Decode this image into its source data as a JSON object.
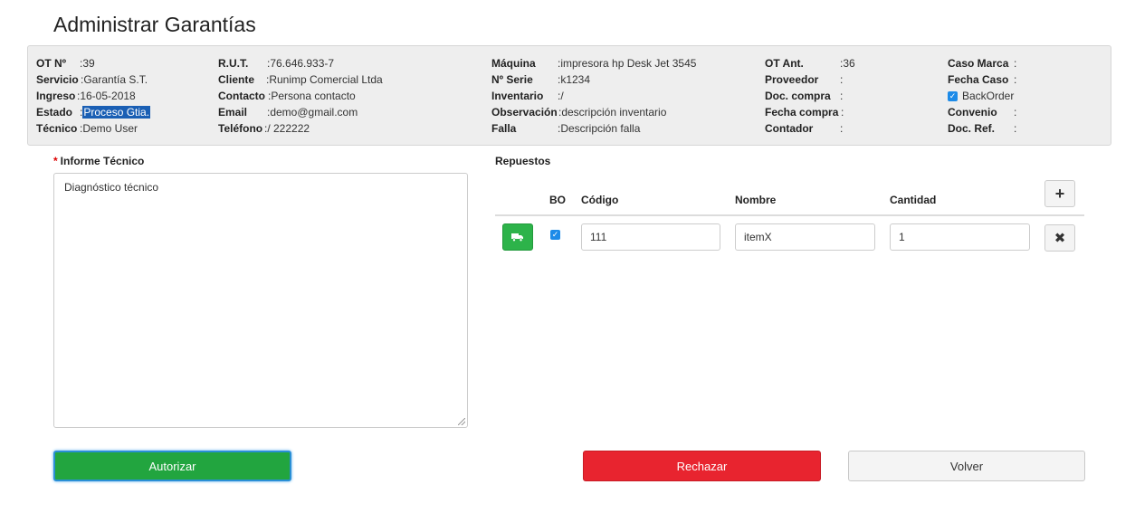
{
  "page": {
    "title": "Administrar Garantías"
  },
  "info": {
    "col1": [
      {
        "label": "OT Nº",
        "value": ":39"
      },
      {
        "label": "Servicio",
        "value": ":Garantía S.T."
      },
      {
        "label": "Ingreso",
        "value": ":16-05-2018"
      },
      {
        "label": "Estado",
        "value_prefix": ":",
        "value": "Proceso Gtia."
      },
      {
        "label": "Técnico",
        "value": ":Demo User"
      }
    ],
    "col2": [
      {
        "label": "R.U.T.",
        "value": ":76.646.933-7"
      },
      {
        "label": "Cliente",
        "value": ":Runimp Comercial Ltda"
      },
      {
        "label": "Contacto",
        "value": ":Persona contacto"
      },
      {
        "label": "Email",
        "value": ":demo@gmail.com"
      },
      {
        "label": "Teléfono",
        "value": ":/ 222222"
      }
    ],
    "col3": [
      {
        "label": "Máquina",
        "value": ":impresora hp Desk Jet 3545"
      },
      {
        "label": "Nº Serie",
        "value": ":k1234"
      },
      {
        "label": "Inventario",
        "value": ":/"
      },
      {
        "label": "Observación",
        "value": ":descripción inventario"
      },
      {
        "label": "Falla",
        "value": ":Descripción falla"
      }
    ],
    "col4": [
      {
        "label": "OT Ant.",
        "value": ":36"
      },
      {
        "label": "Proveedor",
        "value": ":"
      },
      {
        "label": "Doc. compra",
        "value": ":"
      },
      {
        "label": "Fecha compra",
        "value": ":"
      },
      {
        "label": "Contador",
        "value": ":"
      }
    ],
    "col5": [
      {
        "label": "Caso Marca",
        "value": ":"
      },
      {
        "label": "Fecha Caso",
        "value": ":"
      },
      {
        "label": "",
        "value": "BackOrder",
        "checked": true
      },
      {
        "label": "Convenio",
        "value": ":"
      },
      {
        "label": "Doc. Ref.",
        "value": ":"
      }
    ]
  },
  "informe": {
    "label": "Informe Técnico",
    "required_mark": "*",
    "value": "Diagnóstico técnico"
  },
  "repuestos": {
    "label": "Repuestos",
    "headers": {
      "bo": "BO",
      "codigo": "Código",
      "nombre": "Nombre",
      "cantidad": "Cantidad"
    },
    "add_icon": "plus-icon",
    "rows": [
      {
        "bo_checked": true,
        "codigo": "111",
        "nombre": "itemX",
        "cantidad": "1",
        "action_icon": "truck-icon",
        "remove_icon": "close-icon"
      }
    ]
  },
  "actions": {
    "autorizar": "Autorizar",
    "rechazar": "Rechazar",
    "volver": "Volver"
  },
  "colors": {
    "success": "#22a53f",
    "danger": "#e8242f",
    "checkbox": "#1d8be8",
    "selection": "#1a5fb4"
  }
}
